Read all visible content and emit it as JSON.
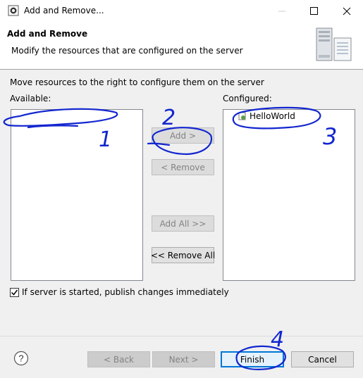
{
  "window": {
    "title": "Add and Remove..."
  },
  "header": {
    "title": "Add and Remove",
    "description": "Modify the resources that are configured on the server"
  },
  "body": {
    "instruction": "Move resources to the right to configure them on the server",
    "available_label": "Available:",
    "configured_label": "Configured:",
    "configured_items": [
      "HelloWorld"
    ],
    "buttons": {
      "add": "Add >",
      "remove": "< Remove",
      "add_all": "Add All >>",
      "remove_all": "<< Remove All"
    },
    "publish_checkbox": {
      "label": "If server is started, publish changes immediately",
      "checked": true
    }
  },
  "footer": {
    "help": "?",
    "back": "< Back",
    "next": "Next >",
    "finish": "Finish",
    "cancel": "Cancel"
  },
  "annotations": [
    "1",
    "2",
    "3",
    "4"
  ],
  "colors": {
    "annotation_ink": "#1226cf",
    "focus_blue": "#0078d7"
  }
}
